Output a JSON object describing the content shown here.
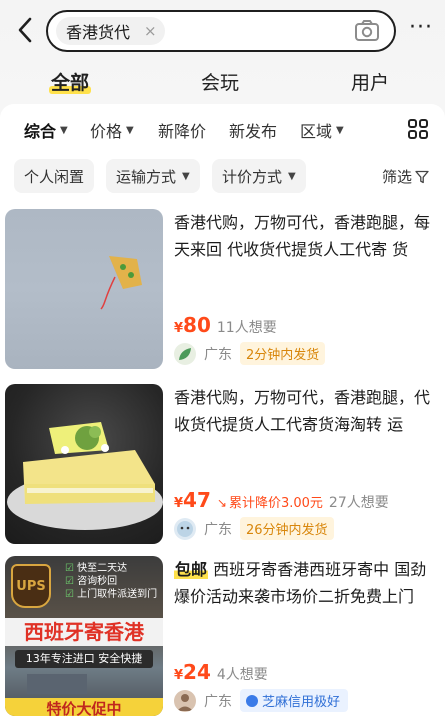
{
  "search": {
    "query": "香港货代",
    "clear": "×"
  },
  "more": "···",
  "main_tabs": [
    {
      "label": "全部",
      "active": true
    },
    {
      "label": "会玩",
      "active": false
    },
    {
      "label": "用户",
      "active": false
    }
  ],
  "sort_bar": {
    "overall": "综合",
    "price": "价格",
    "new_drop": "新降价",
    "new_post": "新发布",
    "region": "区域"
  },
  "filters": {
    "personal": "个人闲置",
    "shipping": "运输方式",
    "pricing": "计价方式",
    "screen": "筛选"
  },
  "items": [
    {
      "title": "香港代购，万物可代，香港跑腿，每天来回 代收货代提货人工代寄 货",
      "yen": "¥",
      "price": "80",
      "wants": "11人想要",
      "location": "广东",
      "tag": "2分钟内发货"
    },
    {
      "title": "香港代购，万物可代，香港跑腿，代收货代提货人工代寄货海淘转 运",
      "yen": "¥",
      "price": "47",
      "drop_label": "累计降价3.00元",
      "wants": "27人想要",
      "location": "广东",
      "tag": "26分钟内发货"
    },
    {
      "badge": "包邮",
      "title": " 西班牙寄香港西班牙寄中 国劲爆价活动来袭市场价二折免费上门",
      "yen": "¥",
      "price": "24",
      "wants": "4人想要",
      "location": "广东",
      "tag": "芝麻信用极好",
      "thumb_text": {
        "ups": "UPS",
        "l1": "快至二天达",
        "l2": "咨询秒回",
        "l3": "上门取件派送到门",
        "banner": "西班牙寄香港",
        "sub": "13年专注进口 安全快捷",
        "bottom": "特价大促中"
      }
    }
  ],
  "colors": {
    "accent_yellow": "#ffe14b",
    "price_red": "#ff4a1a",
    "ship_orange": "#d8860b",
    "credit_blue": "#2f6fd6"
  }
}
